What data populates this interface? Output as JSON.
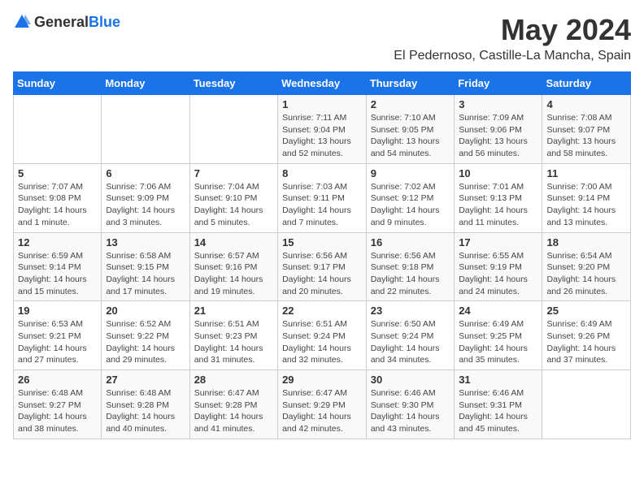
{
  "logo": {
    "general": "General",
    "blue": "Blue"
  },
  "title": "May 2024",
  "location": "El Pedernoso, Castille-La Mancha, Spain",
  "weekdays": [
    "Sunday",
    "Monday",
    "Tuesday",
    "Wednesday",
    "Thursday",
    "Friday",
    "Saturday"
  ],
  "weeks": [
    [
      {
        "day": "",
        "info": ""
      },
      {
        "day": "",
        "info": ""
      },
      {
        "day": "",
        "info": ""
      },
      {
        "day": "1",
        "info": "Sunrise: 7:11 AM\nSunset: 9:04 PM\nDaylight: 13 hours and 52 minutes."
      },
      {
        "day": "2",
        "info": "Sunrise: 7:10 AM\nSunset: 9:05 PM\nDaylight: 13 hours and 54 minutes."
      },
      {
        "day": "3",
        "info": "Sunrise: 7:09 AM\nSunset: 9:06 PM\nDaylight: 13 hours and 56 minutes."
      },
      {
        "day": "4",
        "info": "Sunrise: 7:08 AM\nSunset: 9:07 PM\nDaylight: 13 hours and 58 minutes."
      }
    ],
    [
      {
        "day": "5",
        "info": "Sunrise: 7:07 AM\nSunset: 9:08 PM\nDaylight: 14 hours and 1 minute."
      },
      {
        "day": "6",
        "info": "Sunrise: 7:06 AM\nSunset: 9:09 PM\nDaylight: 14 hours and 3 minutes."
      },
      {
        "day": "7",
        "info": "Sunrise: 7:04 AM\nSunset: 9:10 PM\nDaylight: 14 hours and 5 minutes."
      },
      {
        "day": "8",
        "info": "Sunrise: 7:03 AM\nSunset: 9:11 PM\nDaylight: 14 hours and 7 minutes."
      },
      {
        "day": "9",
        "info": "Sunrise: 7:02 AM\nSunset: 9:12 PM\nDaylight: 14 hours and 9 minutes."
      },
      {
        "day": "10",
        "info": "Sunrise: 7:01 AM\nSunset: 9:13 PM\nDaylight: 14 hours and 11 minutes."
      },
      {
        "day": "11",
        "info": "Sunrise: 7:00 AM\nSunset: 9:14 PM\nDaylight: 14 hours and 13 minutes."
      }
    ],
    [
      {
        "day": "12",
        "info": "Sunrise: 6:59 AM\nSunset: 9:14 PM\nDaylight: 14 hours and 15 minutes."
      },
      {
        "day": "13",
        "info": "Sunrise: 6:58 AM\nSunset: 9:15 PM\nDaylight: 14 hours and 17 minutes."
      },
      {
        "day": "14",
        "info": "Sunrise: 6:57 AM\nSunset: 9:16 PM\nDaylight: 14 hours and 19 minutes."
      },
      {
        "day": "15",
        "info": "Sunrise: 6:56 AM\nSunset: 9:17 PM\nDaylight: 14 hours and 20 minutes."
      },
      {
        "day": "16",
        "info": "Sunrise: 6:56 AM\nSunset: 9:18 PM\nDaylight: 14 hours and 22 minutes."
      },
      {
        "day": "17",
        "info": "Sunrise: 6:55 AM\nSunset: 9:19 PM\nDaylight: 14 hours and 24 minutes."
      },
      {
        "day": "18",
        "info": "Sunrise: 6:54 AM\nSunset: 9:20 PM\nDaylight: 14 hours and 26 minutes."
      }
    ],
    [
      {
        "day": "19",
        "info": "Sunrise: 6:53 AM\nSunset: 9:21 PM\nDaylight: 14 hours and 27 minutes."
      },
      {
        "day": "20",
        "info": "Sunrise: 6:52 AM\nSunset: 9:22 PM\nDaylight: 14 hours and 29 minutes."
      },
      {
        "day": "21",
        "info": "Sunrise: 6:51 AM\nSunset: 9:23 PM\nDaylight: 14 hours and 31 minutes."
      },
      {
        "day": "22",
        "info": "Sunrise: 6:51 AM\nSunset: 9:24 PM\nDaylight: 14 hours and 32 minutes."
      },
      {
        "day": "23",
        "info": "Sunrise: 6:50 AM\nSunset: 9:24 PM\nDaylight: 14 hours and 34 minutes."
      },
      {
        "day": "24",
        "info": "Sunrise: 6:49 AM\nSunset: 9:25 PM\nDaylight: 14 hours and 35 minutes."
      },
      {
        "day": "25",
        "info": "Sunrise: 6:49 AM\nSunset: 9:26 PM\nDaylight: 14 hours and 37 minutes."
      }
    ],
    [
      {
        "day": "26",
        "info": "Sunrise: 6:48 AM\nSunset: 9:27 PM\nDaylight: 14 hours and 38 minutes."
      },
      {
        "day": "27",
        "info": "Sunrise: 6:48 AM\nSunset: 9:28 PM\nDaylight: 14 hours and 40 minutes."
      },
      {
        "day": "28",
        "info": "Sunrise: 6:47 AM\nSunset: 9:28 PM\nDaylight: 14 hours and 41 minutes."
      },
      {
        "day": "29",
        "info": "Sunrise: 6:47 AM\nSunset: 9:29 PM\nDaylight: 14 hours and 42 minutes."
      },
      {
        "day": "30",
        "info": "Sunrise: 6:46 AM\nSunset: 9:30 PM\nDaylight: 14 hours and 43 minutes."
      },
      {
        "day": "31",
        "info": "Sunrise: 6:46 AM\nSunset: 9:31 PM\nDaylight: 14 hours and 45 minutes."
      },
      {
        "day": "",
        "info": ""
      }
    ]
  ]
}
